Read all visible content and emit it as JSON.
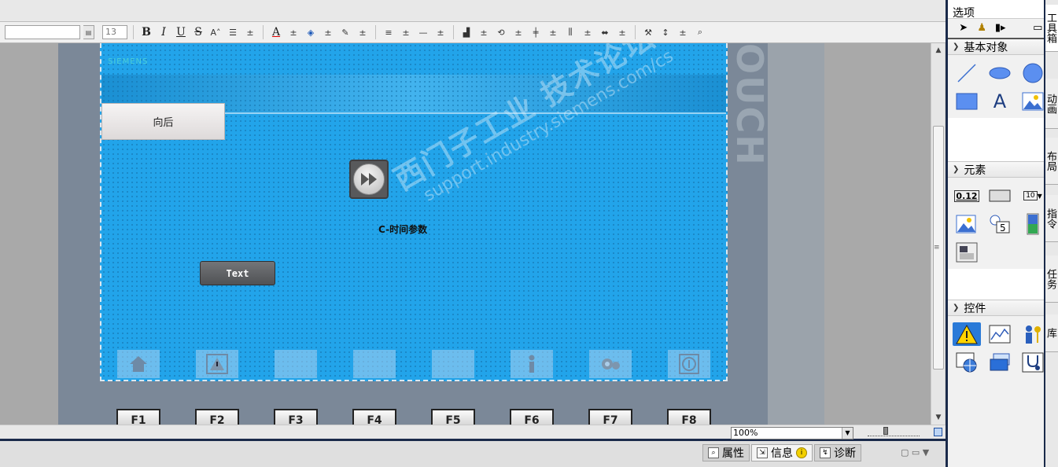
{
  "format_toolbar": {
    "font_size": "13",
    "bold": "B",
    "italic": "I",
    "underline": "U",
    "strike": "S",
    "font_color": "A",
    "grow_font": "A˄",
    "dropdown": "±"
  },
  "screen": {
    "logo": "SIEMENS",
    "back_button": "向后",
    "label": "C-时间参数",
    "text_button": "Text",
    "nav_icons": [
      "home-icon",
      "alarm-icon",
      "",
      "",
      "",
      "user-icon",
      "settings-icon",
      "info-icon"
    ]
  },
  "device": {
    "brand": "OUCH",
    "fkeys": [
      "F1",
      "F2",
      "F3",
      "F4",
      "F5",
      "F6",
      "F7",
      "F8"
    ]
  },
  "watermark": {
    "line1": "西门子工业 技术论坛",
    "line2": "support.industry.siemens.com/cs"
  },
  "zoom": {
    "value": "100%"
  },
  "status_tabs": [
    {
      "label": "属性",
      "icon": "properties-icon",
      "active": false
    },
    {
      "label": "信息",
      "icon": "info-tab-icon",
      "active": true
    },
    {
      "label": "诊断",
      "icon": "diagnostics-icon",
      "active": false
    }
  ],
  "toolbox": {
    "header": "选项",
    "sections": {
      "basic_objects": "基本对象",
      "elements": "元素",
      "controls": "控件"
    },
    "elements_io_label": "0.12",
    "elements_clock_label": "5",
    "elements_list_label": "10"
  },
  "side_tabs": [
    "工具箱",
    "动画",
    "布局",
    "指令",
    "任务",
    "库"
  ],
  "colors": {
    "screen_bg": "#22a4ea",
    "device_frame": "#7b8898",
    "accent_dark": "#1a2a4a"
  }
}
